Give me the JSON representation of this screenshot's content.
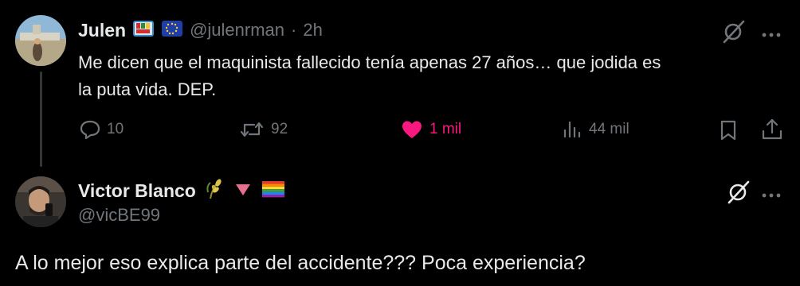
{
  "tweet1": {
    "author_name": "Julen",
    "handle": "@julenrman",
    "separator": "·",
    "time": "2h",
    "text_line1": "Me dicen que el maquinista fallecido tenía apenas 27 años… que jodida es",
    "text_line2": "la puta vida. DEP.",
    "badges": [
      "ikurriña-flag-emoji",
      "european-union-flag-emoji"
    ],
    "actions": {
      "replies": "10",
      "retweets": "92",
      "likes": "1 mil",
      "views": "44 mil"
    },
    "liked": true,
    "colors": {
      "like": "#f91880",
      "muted": "#71767b",
      "text": "#e7e9ea"
    }
  },
  "tweet2": {
    "author_name": "Victor Blanco",
    "handle": "@vicBE99",
    "badges": [
      "plant-emoji",
      "pink-triangle-emoji",
      "rainbow-flag-emoji"
    ],
    "text": "A lo mejor eso explica parte del accidente??? Poca experiencia?"
  },
  "icons": {
    "grok": "grok-slash-circle-icon",
    "more": "more-dots-icon",
    "reply": "reply-bubble-icon",
    "retweet": "retweet-icon",
    "like": "heart-icon",
    "views": "views-bar-chart-icon",
    "bookmark": "bookmark-icon",
    "share": "share-icon"
  }
}
